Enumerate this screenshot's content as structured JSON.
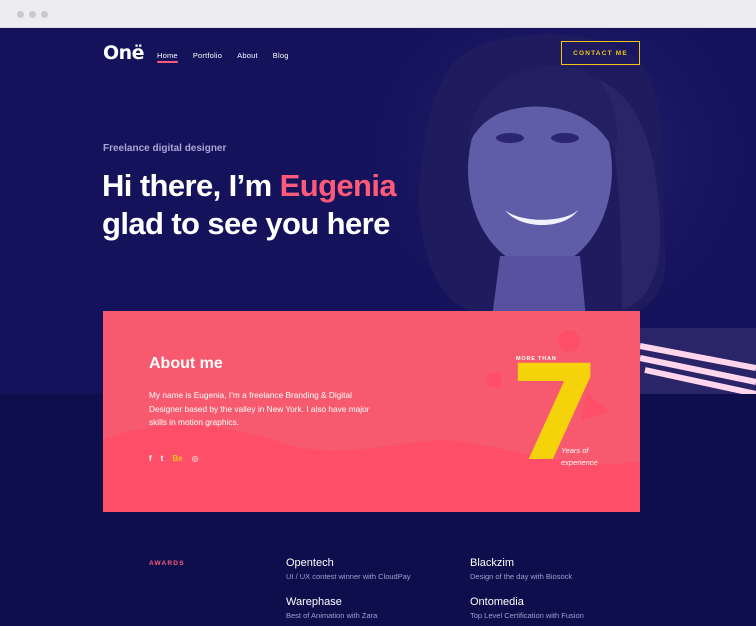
{
  "header": {
    "logo": "Onë",
    "nav": [
      "Home",
      "Portfolio",
      "About",
      "Blog"
    ],
    "contact_button": "CONTACT ME"
  },
  "hero": {
    "eyebrow": "Freelance digital designer",
    "line1_prefix": "Hi there, I’m ",
    "line1_name": "Eugenia",
    "line2": "glad to see you here"
  },
  "about": {
    "title": "About me",
    "text": "My name is Eugenia, I’m a freelance Branding & Digital Designer based by the valley in New York. I also have major skills in motion graphics.",
    "socials": [
      "f",
      "t",
      "Be",
      "◎"
    ],
    "more_than": "MORE THAN",
    "number": "7",
    "years_line1": "Years of",
    "years_line2": "experience"
  },
  "awards": {
    "label": "AWARDS",
    "items": [
      {
        "name": "Opentech",
        "desc": "UI / UX contest winner with CloudPay"
      },
      {
        "name": "Blackzim",
        "desc": "Design of the day with Biosock"
      },
      {
        "name": "Warephase",
        "desc": "Best of Animation with Zara"
      },
      {
        "name": "Ontomedia",
        "desc": "Top Level Certification with Fusion"
      }
    ]
  },
  "colors": {
    "background": "#14125a",
    "accent_pink": "#ff5a7a",
    "card": "#f75a6e",
    "yellow": "#f5d30a",
    "button_border": "#f2c517"
  }
}
